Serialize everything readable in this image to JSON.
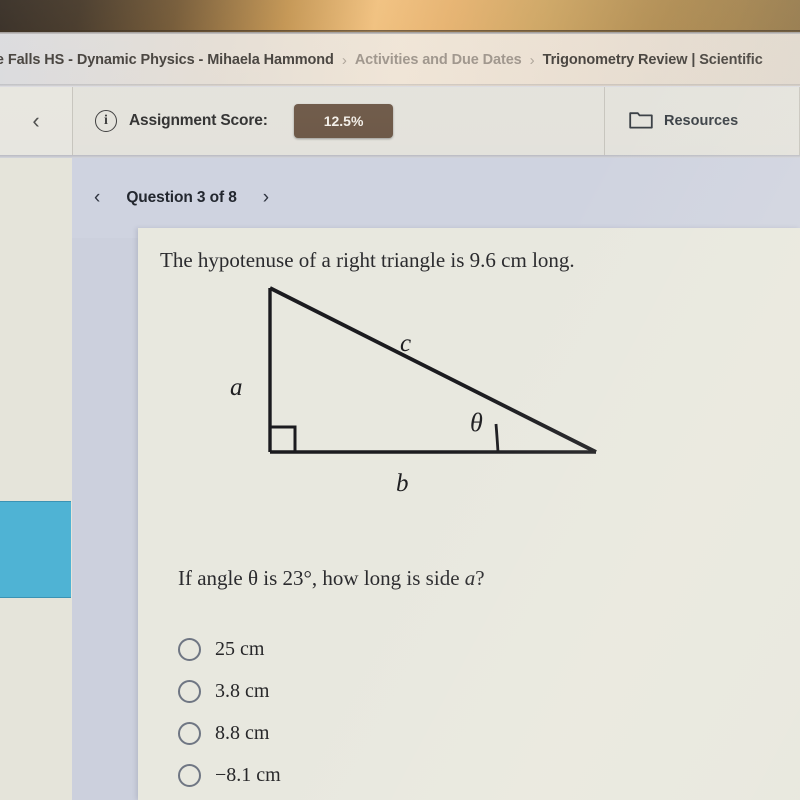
{
  "breadcrumb": {
    "item1": "le Falls HS - Dynamic Physics - Mihaela Hammond",
    "sep1": "›",
    "item2": "Activities and Due Dates",
    "sep2": "›",
    "item3": "Trigonometry Review | Scientific"
  },
  "toolbar": {
    "back_chevron": "‹",
    "info_icon_glyph": "i",
    "score_label": "Assignment Score:",
    "score_value": "12.5%",
    "score_badge_color": "#6b5645",
    "resources_label": "Resources"
  },
  "question_nav": {
    "prev_chevron": "‹",
    "next_chevron": "›",
    "counter": "Question 3 of 8",
    "current": 3,
    "total": 8
  },
  "question": {
    "prompt": "The hypotenuse of a right triangle is 9.6 cm long.",
    "ask_prefix": "If angle θ is 23°, how long is side ",
    "ask_variable": "a",
    "ask_suffix": "?",
    "angle_value": "23°",
    "hypotenuse_value": "9.6 cm"
  },
  "figure": {
    "label_a": "a",
    "label_b": "b",
    "label_c": "c",
    "label_theta": "θ",
    "stroke_color": "#1b1b1f"
  },
  "options": [
    {
      "label": "25 cm",
      "selected": false
    },
    {
      "label": "3.8 cm",
      "selected": false
    },
    {
      "label": "8.8 cm",
      "selected": false
    },
    {
      "label": "−8.1 cm",
      "selected": false
    }
  ],
  "sidebar": {
    "highlight_color": "#4fb3d4"
  }
}
